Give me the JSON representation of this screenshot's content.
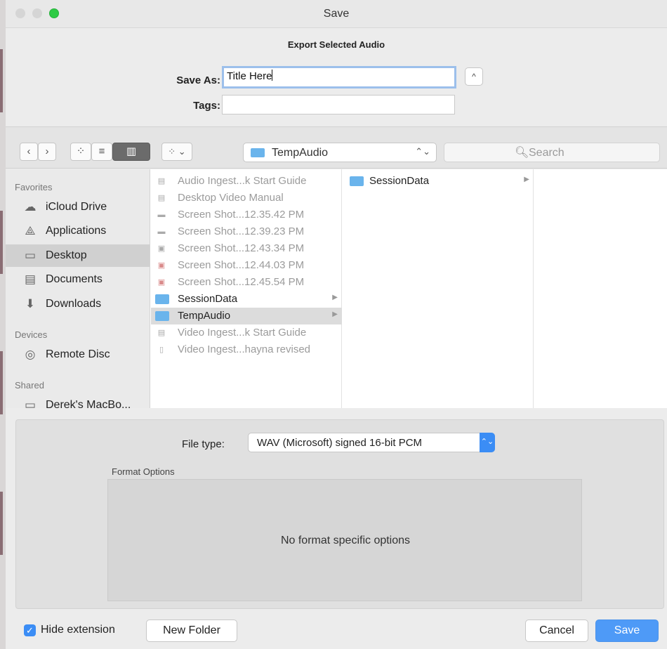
{
  "window": {
    "title": "Save"
  },
  "header": {
    "subtitle": "Export Selected Audio",
    "save_as_label": "Save As:",
    "save_as_value": "Title Here",
    "tags_label": "Tags:",
    "tags_value": "",
    "collapse_glyph": "^"
  },
  "toolbar": {
    "back_glyph": "‹",
    "forward_glyph": "›",
    "view_icons_glyph": "⁘",
    "view_list_glyph": "≡",
    "view_columns_glyph": "▥",
    "arrange_glyph": "⁘ ⌄",
    "location": "TempAudio",
    "location_updown": "⌃⌄",
    "search_placeholder": "Search",
    "search_glyph": "🔍︎"
  },
  "sidebar": {
    "favorites_header": "Favorites",
    "favorites": [
      {
        "label": "iCloud Drive",
        "icon": "cloud-icon"
      },
      {
        "label": "Applications",
        "icon": "applications-icon"
      },
      {
        "label": "Desktop",
        "icon": "desktop-icon"
      },
      {
        "label": "Documents",
        "icon": "documents-icon"
      },
      {
        "label": "Downloads",
        "icon": "downloads-icon"
      }
    ],
    "selected": "Desktop",
    "devices_header": "Devices",
    "devices": [
      {
        "label": "Remote Disc",
        "icon": "disc-icon"
      }
    ],
    "shared_header": "Shared",
    "shared": [
      {
        "label": "Derek's MacBo...",
        "icon": "computer-icon"
      }
    ]
  },
  "columns": {
    "col1": [
      {
        "name": "Audio Ingest...k Start Guide",
        "kind": "doc",
        "dim": true
      },
      {
        "name": "Desktop Video Manual",
        "kind": "doc",
        "dim": true
      },
      {
        "name": "Screen Shot...12.35.42 PM",
        "kind": "image",
        "dim": true
      },
      {
        "name": "Screen Shot...12.39.23 PM",
        "kind": "image",
        "dim": true
      },
      {
        "name": "Screen Shot...12.43.34 PM",
        "kind": "image",
        "dim": true
      },
      {
        "name": "Screen Shot...12.44.03 PM",
        "kind": "image",
        "dim": true
      },
      {
        "name": "Screen Shot...12.45.54 PM",
        "kind": "image",
        "dim": true
      },
      {
        "name": "SessionData",
        "kind": "folder",
        "dim": false
      },
      {
        "name": "TempAudio",
        "kind": "folder",
        "dim": false
      },
      {
        "name": "Video Ingest...k Start Guide",
        "kind": "doc",
        "dim": true
      },
      {
        "name": "Video Ingest...hayna revised",
        "kind": "doc",
        "dim": true
      }
    ],
    "col1_selected": "TempAudio",
    "col2": [
      {
        "name": "SessionData",
        "kind": "folder",
        "dim": false
      }
    ]
  },
  "options": {
    "file_type_label": "File type:",
    "file_type_value": "WAV (Microsoft) signed 16-bit PCM",
    "file_type_stepper": "⌃⌄",
    "format_options_label": "Format Options",
    "format_options_message": "No format specific options"
  },
  "footer": {
    "hide_extension_checked": true,
    "check_glyph": "✓",
    "hide_extension_label": "Hide extension",
    "new_folder_label": "New Folder",
    "cancel_label": "Cancel",
    "save_label": "Save"
  },
  "colors": {
    "accent": "#3b8df5",
    "folder": "#6ab4ec",
    "zoom_button": "#2ecb45"
  }
}
